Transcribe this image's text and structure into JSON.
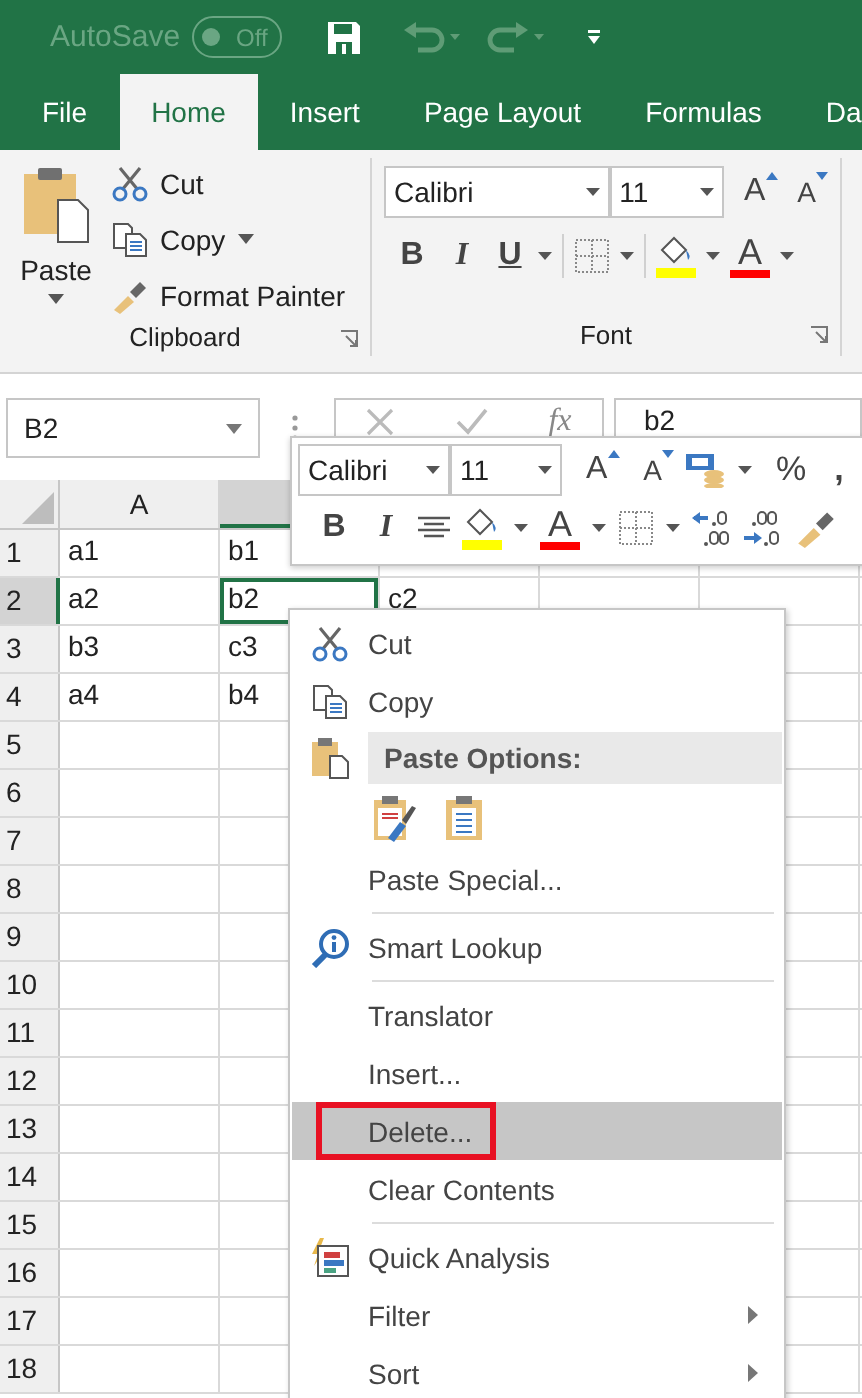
{
  "title_bar": {
    "autosave_label": "AutoSave",
    "autosave": {
      "label": "Off",
      "on": false
    }
  },
  "tabs": [
    {
      "label": "File",
      "selected": false
    },
    {
      "label": "Home",
      "selected": true
    },
    {
      "label": "Insert",
      "selected": false
    },
    {
      "label": "Page Layout",
      "selected": false
    },
    {
      "label": "Formulas",
      "selected": false
    },
    {
      "label": "Da",
      "selected": false
    }
  ],
  "clipboard": {
    "paste": "Paste",
    "label": "Clipboard",
    "commands": [
      {
        "kind": "cut",
        "label": "Cut",
        "dropdown": false
      },
      {
        "kind": "copy",
        "label": "Copy",
        "dropdown": true
      },
      {
        "kind": "painter",
        "label": "Format Painter",
        "dropdown": false
      }
    ]
  },
  "font_group": {
    "font": "Calibri",
    "size": "11",
    "grow": "A",
    "shrink": "A",
    "bold": "B",
    "italic": "I",
    "underline": "U",
    "font_color": "A",
    "label": "Font"
  },
  "formula_bar": {
    "name_box": "B2",
    "function": "fx",
    "formula": "b2"
  },
  "grid": {
    "columns": [
      {
        "label": "A",
        "selected": false
      },
      {
        "selected": true
      }
    ],
    "rows": [
      {
        "number": "1",
        "selected": false,
        "cells": [
          {
            "text": "a1",
            "selected": false
          },
          {
            "text": "b1",
            "selected": false
          }
        ]
      },
      {
        "number": "2",
        "selected": true,
        "cells": [
          {
            "text": "a2",
            "selected": false
          },
          {
            "text": "b2",
            "selected": true
          },
          {
            "text": "c2",
            "selected": false
          }
        ]
      },
      {
        "number": "3",
        "selected": false,
        "cells": [
          {
            "text": "b3",
            "selected": false
          },
          {
            "text": "c3",
            "selected": false
          }
        ]
      },
      {
        "number": "4",
        "selected": false,
        "cells": [
          {
            "text": "a4",
            "selected": false
          },
          {
            "text": "b4",
            "selected": false
          }
        ]
      },
      {
        "number": "5",
        "selected": false
      },
      {
        "number": "6",
        "selected": false
      },
      {
        "number": "7",
        "selected": false
      },
      {
        "number": "8",
        "selected": false
      },
      {
        "number": "9",
        "selected": false
      },
      {
        "number": "10",
        "selected": false
      },
      {
        "number": "11",
        "selected": false
      },
      {
        "number": "12",
        "selected": false
      },
      {
        "number": "13",
        "selected": false
      },
      {
        "number": "14",
        "selected": false
      },
      {
        "number": "15",
        "selected": false
      },
      {
        "number": "16",
        "selected": false
      },
      {
        "number": "17",
        "selected": false
      },
      {
        "number": "18",
        "selected": false
      }
    ]
  },
  "mini_toolbar": {
    "font": "Calibri",
    "size": "11",
    "grow": "A",
    "shrink": "A",
    "percent": "%",
    "comma": ",",
    "bold": "B",
    "italic": "I",
    "font_color": "A"
  },
  "context_menu": {
    "items": [
      {
        "kind": "cut",
        "label": "Cut",
        "highlighted": false,
        "outlined": false
      },
      {
        "kind": "copy",
        "label": "Copy",
        "highlighted": false,
        "outlined": false
      },
      {
        "kind": "header",
        "label": "Paste Options:"
      },
      {
        "kind": "pasteicons"
      },
      {
        "kind": "plain",
        "label": "Paste Special...",
        "highlighted": false,
        "outlined": false
      },
      {
        "kind": "divider"
      },
      {
        "kind": "lookup",
        "label": "Smart Lookup",
        "highlighted": false,
        "outlined": false
      },
      {
        "kind": "divider"
      },
      {
        "kind": "plain",
        "label": "Translator",
        "highlighted": false,
        "outlined": false
      },
      {
        "kind": "plain",
        "label": "Insert...",
        "highlighted": false,
        "outlined": false
      },
      {
        "kind": "plain",
        "label": "Delete...",
        "highlighted": true,
        "outlined": true
      },
      {
        "kind": "plain",
        "label": "Clear Contents",
        "highlighted": false,
        "outlined": false
      },
      {
        "kind": "divider"
      },
      {
        "kind": "analysis",
        "label": "Quick Analysis",
        "highlighted": false,
        "outlined": false
      },
      {
        "kind": "submenu",
        "label": "Filter",
        "highlighted": false,
        "outlined": false
      },
      {
        "kind": "submenu",
        "label": "Sort",
        "highlighted": false,
        "outlined": false
      }
    ]
  }
}
